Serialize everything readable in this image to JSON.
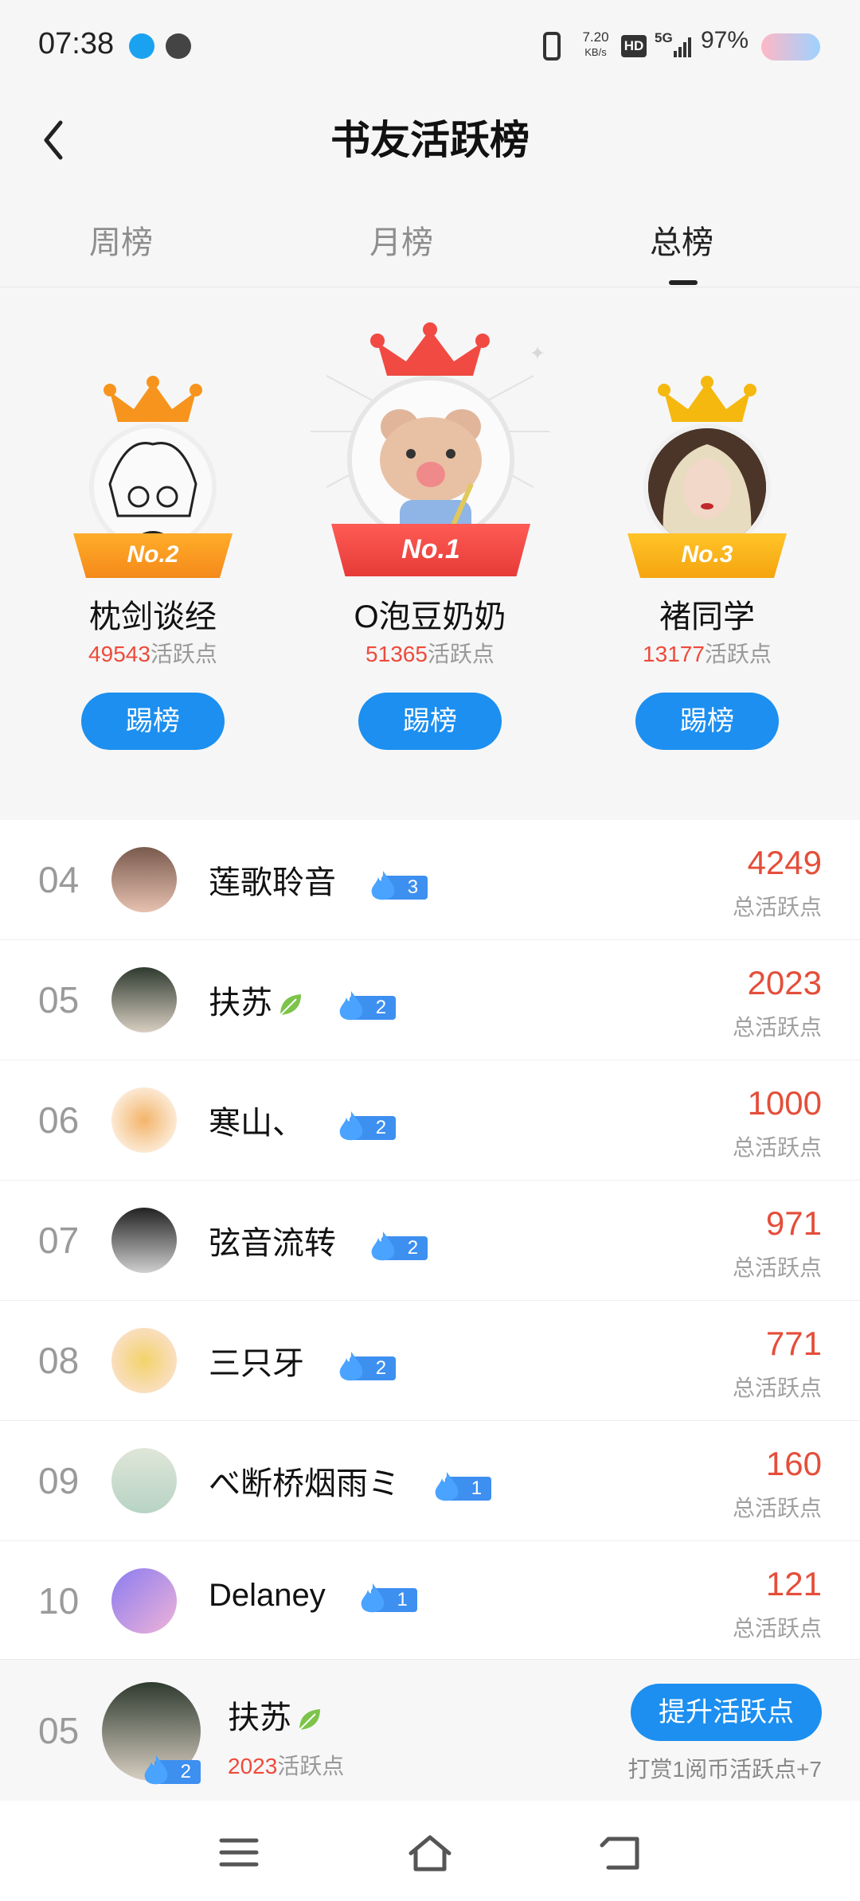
{
  "status_bar": {
    "time": "07:38",
    "net_speed_value": "7.20",
    "net_speed_unit": "KB/s",
    "hd": "HD",
    "signal": "5G",
    "battery": "97%"
  },
  "header": {
    "title": "书友活跃榜"
  },
  "tabs": [
    {
      "label": "周榜",
      "active": false
    },
    {
      "label": "月榜",
      "active": false
    },
    {
      "label": "总榜",
      "active": true
    }
  ],
  "podium": {
    "kick_label": "踢榜",
    "score_suffix": "活跃点",
    "first": {
      "badge": "No.1",
      "name": "O泡豆奶奶",
      "score": "51365"
    },
    "second": {
      "badge": "No.2",
      "name": "枕剑谈经",
      "score": "49543"
    },
    "third": {
      "badge": "No.3",
      "name": "褚同学",
      "score": "13177"
    }
  },
  "list": {
    "score_label": "总活跃点",
    "rows": [
      {
        "rank": "04",
        "name": "莲歌聆音",
        "level": "3",
        "score": "4249"
      },
      {
        "rank": "05",
        "name": "扶苏",
        "level": "2",
        "score": "2023"
      },
      {
        "rank": "06",
        "name": "寒山、",
        "level": "2",
        "score": "1000"
      },
      {
        "rank": "07",
        "name": "弦音流转",
        "level": "2",
        "score": "971"
      },
      {
        "rank": "08",
        "name": "三只牙",
        "level": "2",
        "score": "771"
      },
      {
        "rank": "09",
        "name": "べ断桥烟雨ミ",
        "level": "1",
        "score": "160"
      },
      {
        "rank": "10",
        "name": "Delaney",
        "level": "1",
        "score": "121"
      }
    ]
  },
  "my_rank": {
    "rank": "05",
    "name": "扶苏",
    "level": "2",
    "score": "2023",
    "score_suffix": "活跃点",
    "boost_label": "提升活跃点",
    "tip": "打赏1阅币活跃点+7"
  },
  "colors": {
    "accent": "#1c8ff0",
    "score_red": "#e44e3a",
    "gold": "#f5a623",
    "red_crown": "#f04a43",
    "orange_crown": "#f7941d"
  }
}
